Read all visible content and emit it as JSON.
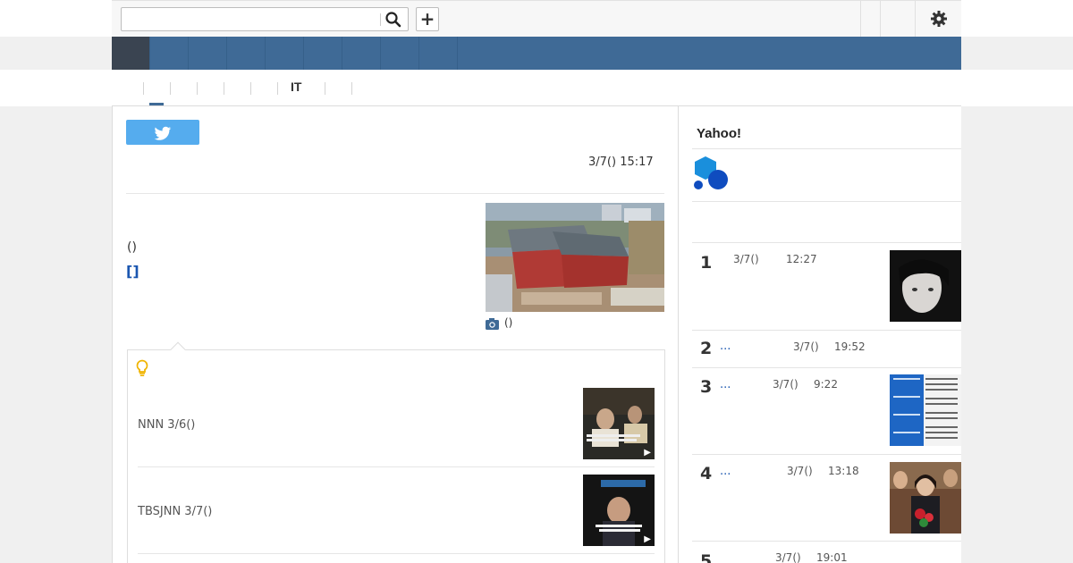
{
  "search": {
    "value": "",
    "placeholder": ""
  },
  "header": {
    "plus_label": "+"
  },
  "subnav": {
    "it_label": "IT"
  },
  "article": {
    "date": "3/7() 15:17",
    "paren_text": "()",
    "bracket_link": "[]",
    "photo_caption": "()"
  },
  "related": {
    "items": [
      {
        "text": "NNN 3/6()"
      },
      {
        "text": "TBSJNN 3/7()"
      }
    ]
  },
  "sidebar": {
    "title": "Yahoo!",
    "ranking": [
      {
        "num": "1",
        "dots": "",
        "date": "3/7()",
        "time": "12:27"
      },
      {
        "num": "2",
        "dots": "...",
        "date": "3/7()",
        "time": "19:52"
      },
      {
        "num": "3",
        "dots": "...",
        "date": "3/7()",
        "time": "9:22"
      },
      {
        "num": "4",
        "dots": "...",
        "date": "3/7()",
        "time": "13:18"
      },
      {
        "num": "5",
        "dots": "",
        "date": "3/7()",
        "time": "19:01"
      }
    ]
  },
  "colors": {
    "nav_blue": "#3f6a96",
    "nav_active": "#3a4451",
    "twitter": "#55acee",
    "link": "#1a56b0",
    "bulb": "#f0b400"
  },
  "icons": [
    "search-icon",
    "plus-icon",
    "gear-icon",
    "twitter-icon",
    "camera-icon",
    "lightbulb-icon",
    "play-icon"
  ]
}
